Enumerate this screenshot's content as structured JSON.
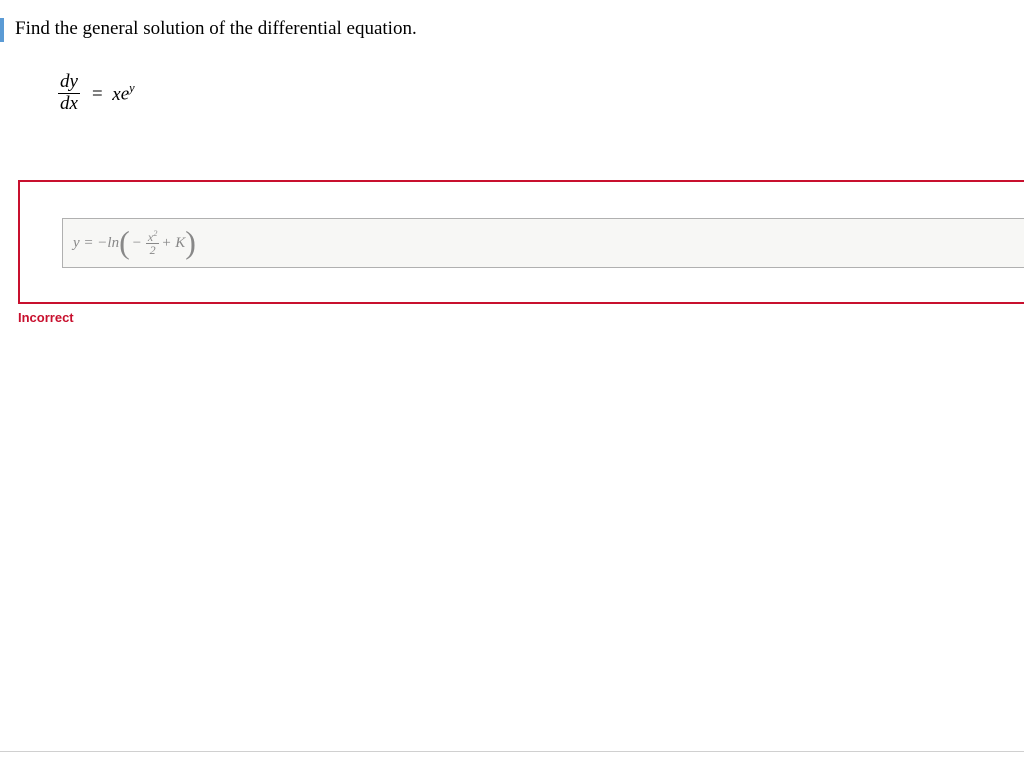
{
  "question": {
    "prompt": "Find the general solution of the differential equation.",
    "equation": {
      "lhs_num": "dy",
      "lhs_den": "dx",
      "rhs_eq": "=",
      "rhs_x": "x",
      "rhs_e": "e",
      "rhs_exp": "y"
    }
  },
  "answer": {
    "prefix": "y = −ln",
    "paren_open": "(",
    "minus": "−",
    "frac_num_x": "x",
    "frac_num_exp": "2",
    "frac_den": "2",
    "plus_k": " + K",
    "paren_close": ")"
  },
  "feedback": {
    "label": "Incorrect"
  }
}
